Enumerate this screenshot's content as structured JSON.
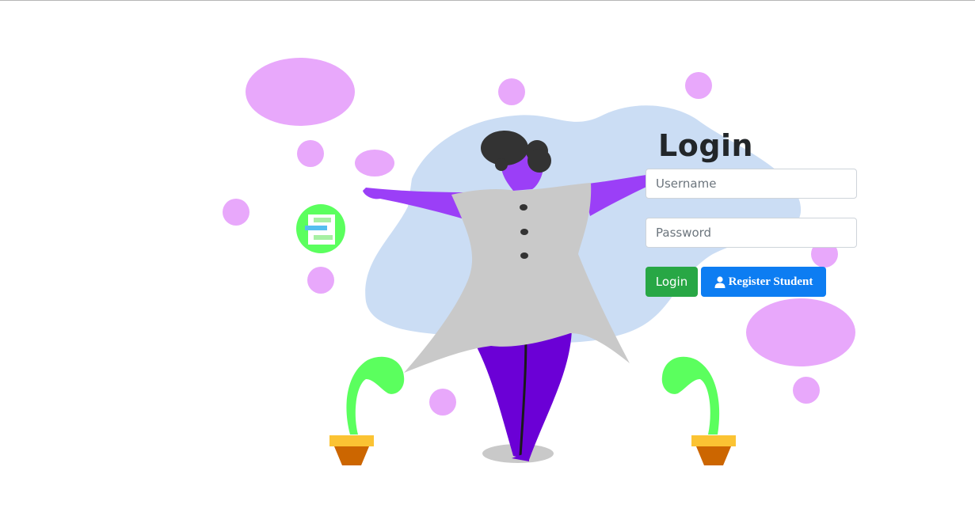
{
  "login": {
    "title": "Login",
    "username_placeholder": "Username",
    "password_placeholder": "Password",
    "login_button": "Login",
    "register_button": "Register Student"
  },
  "icons": {
    "register": "user-icon",
    "illustration": "person-with-plants-illustration"
  },
  "colors": {
    "title_text": "#222629",
    "login_button": "#28a745",
    "register_button": "#0d7df2",
    "accent_purple": "#9b3ff7",
    "bubble_pink": "#e8a8fb",
    "blob_blue": "#cbddf4",
    "plant_green": "#5bff5e"
  }
}
